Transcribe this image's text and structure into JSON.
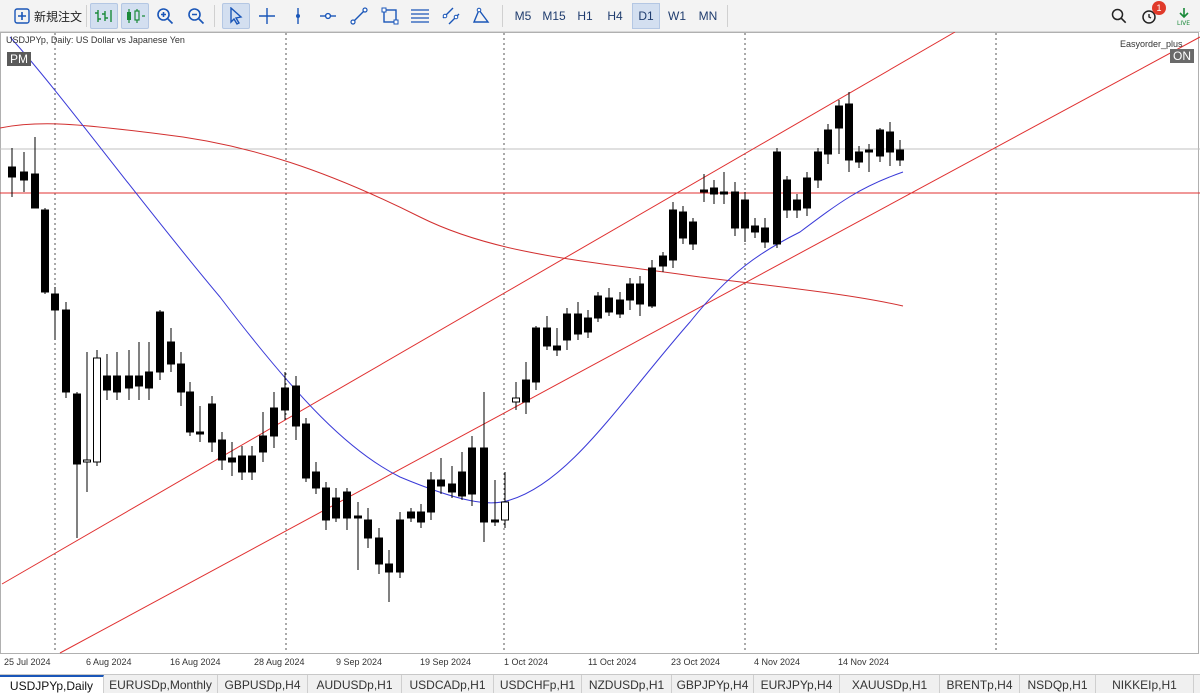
{
  "toolbar": {
    "new_order_label": "新規注文",
    "timeframes": [
      "M5",
      "M15",
      "H1",
      "H4",
      "D1",
      "W1",
      "MN"
    ],
    "active_timeframe": "D1",
    "notification_count": "1"
  },
  "chart": {
    "info_label": "USDJPYp, Daily:  US Dollar vs Japanese Yen",
    "session_tag": "PM",
    "ea_name": "Easyorder_plus",
    "ea_status": "ON",
    "date_labels": [
      "25 Jul 2024",
      "6 Aug 2024",
      "16 Aug 2024",
      "28 Aug 2024",
      "9 Sep 2024",
      "19 Sep 2024",
      "1 Oct 2024",
      "11 Oct 2024",
      "23 Oct 2024",
      "4 Nov 2024",
      "14 Nov 2024"
    ]
  },
  "tabs": [
    "USDJPYp,Daily",
    "EURUSDp,Monthly",
    "GBPUSDp,H4",
    "AUDUSDp,H1",
    "USDCADp,H1",
    "USDCHFp,H1",
    "NZDUSDp,H1",
    "GBPJPYp,H4",
    "EURJPYp,H4",
    "XAUUSDp,H1",
    "BRENTp,H4",
    "NSDQp,H1",
    "NIKKEIp,H1"
  ],
  "active_tab": "USDJPYp,Daily",
  "colors": {
    "accent": "#1a56b8",
    "ma_fast": "#3a3ad8",
    "ma_slow": "#d23030",
    "channel": "#e03030",
    "hline": "#e03030"
  },
  "icons": [
    "new-order-icon",
    "chart-bars-icon",
    "chart-candles-icon",
    "zoom-in-icon",
    "zoom-out-icon",
    "cursor-icon",
    "crosshair-icon",
    "vertical-line-icon",
    "horizontal-line-icon",
    "trend-line-icon",
    "rectangle-icon",
    "fibonacci-icon",
    "channel-icon",
    "triangle-icon",
    "search-icon",
    "notifications-icon",
    "signal-icon"
  ]
}
